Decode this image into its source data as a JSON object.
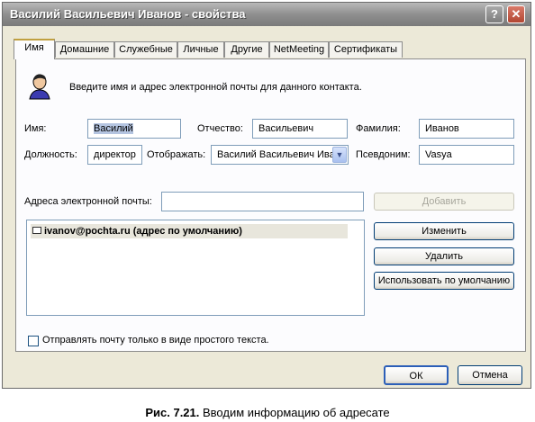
{
  "window": {
    "title": "Василий Васильевич Иванов - свойства",
    "help_glyph": "?",
    "close_glyph": "✕"
  },
  "tabs": [
    {
      "label": "Имя",
      "active": true
    },
    {
      "label": "Домашние"
    },
    {
      "label": "Служебные"
    },
    {
      "label": "Личные"
    },
    {
      "label": "Другие"
    },
    {
      "label": "NetMeeting"
    },
    {
      "label": "Сертификаты"
    }
  ],
  "intro_text": "Введите имя и адрес электронной почты для данного контакта.",
  "form": {
    "first_name": {
      "label": "Имя:",
      "value": "Василий"
    },
    "middle_name": {
      "label": "Отчество:",
      "value": "Васильевич"
    },
    "last_name": {
      "label": "Фамилия:",
      "value": "Иванов"
    },
    "position": {
      "label": "Должность:",
      "value": "директор"
    },
    "display": {
      "label": "Отображать:",
      "value": "Василий Васильевич Ива"
    },
    "nickname": {
      "label": "Псевдоним:",
      "value": "Vasya"
    }
  },
  "email": {
    "label": "Адреса электронной почты:",
    "value": "",
    "entries": [
      "ivanov@pochta.ru  (адрес по умолчанию)"
    ]
  },
  "buttons": {
    "add": "Добавить",
    "edit": "Изменить",
    "remove": "Удалить",
    "set_default": "Использовать по умолчанию",
    "ok": "ОК",
    "cancel": "Отмена"
  },
  "plain_text_checkbox": {
    "label": "Отправлять почту только в виде простого текста.",
    "checked": false
  },
  "caption": {
    "prefix": "Рис. 7.21.",
    "text": "Вводим информацию об адресате"
  }
}
